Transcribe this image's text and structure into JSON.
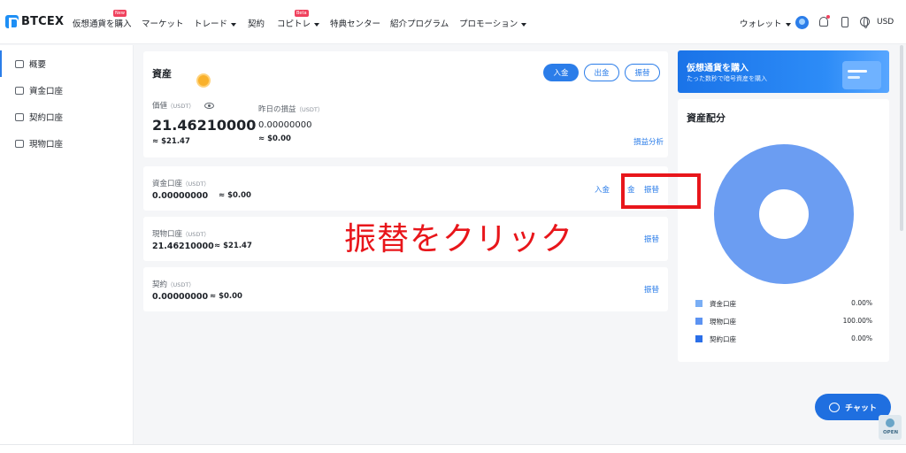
{
  "nav": {
    "logo": "BTCEX",
    "items": [
      {
        "label": "仮想通貨を購入",
        "badge": "New"
      },
      {
        "label": "マーケット"
      },
      {
        "label": "トレード"
      },
      {
        "label": "契約"
      },
      {
        "label": "コピトレ",
        "badge": "Beta"
      },
      {
        "label": "特典センター"
      },
      {
        "label": "紹介プログラム"
      },
      {
        "label": "プロモーション"
      }
    ],
    "wallet": "ウォレット",
    "currency": "USD"
  },
  "sidebar": {
    "items": [
      {
        "label": "概要",
        "icon": "overview-icon"
      },
      {
        "label": "資金口座",
        "icon": "funding-account-icon"
      },
      {
        "label": "契約口座",
        "icon": "contract-account-icon"
      },
      {
        "label": "現物口座",
        "icon": "spot-account-icon"
      }
    ]
  },
  "assets": {
    "title": "資産",
    "buttons": {
      "deposit": "入金",
      "withdraw": "出金",
      "transfer": "振替"
    },
    "value_label": "価値",
    "value_unit": "（USDT）",
    "value": "21.46210000",
    "value_approx": "≈ $21.47",
    "pnl_label": "昨日の損益",
    "pnl_unit": "（USDT）",
    "pnl": "0.00000000",
    "pnl_approx": "≈ $0.00",
    "pnl_analysis": "損益分析"
  },
  "accounts": [
    {
      "label": "資金口座",
      "unit": "（USDT）",
      "value": "0.00000000",
      "approx": "≈ $0.00",
      "link1": "入金",
      "link2": "金",
      "link3": "振替"
    },
    {
      "label": "現物口座",
      "unit": "（USDT）",
      "value": "21.46210000",
      "approx": "≈ $21.47",
      "link3": "振替"
    },
    {
      "label": "契約",
      "unit": "（USDT）",
      "value": "0.00000000",
      "approx": "≈ $0.00",
      "link3": "振替"
    }
  ],
  "promo": {
    "title": "仮想通貨を購入",
    "subtitle": "たった数秒で暗号資産を購入"
  },
  "distribution": {
    "title": "資産配分",
    "legend": [
      {
        "name": "資金口座",
        "pct": "0.00%",
        "color": "#79aef5"
      },
      {
        "name": "現物口座",
        "pct": "100.00%",
        "color": "#5c93f2"
      },
      {
        "name": "契約口座",
        "pct": "0.00%",
        "color": "#2b6fe8"
      }
    ]
  },
  "annotation": {
    "text": "振替をクリック"
  },
  "chat": {
    "label": "チャット"
  },
  "open_badge": "OPEN"
}
